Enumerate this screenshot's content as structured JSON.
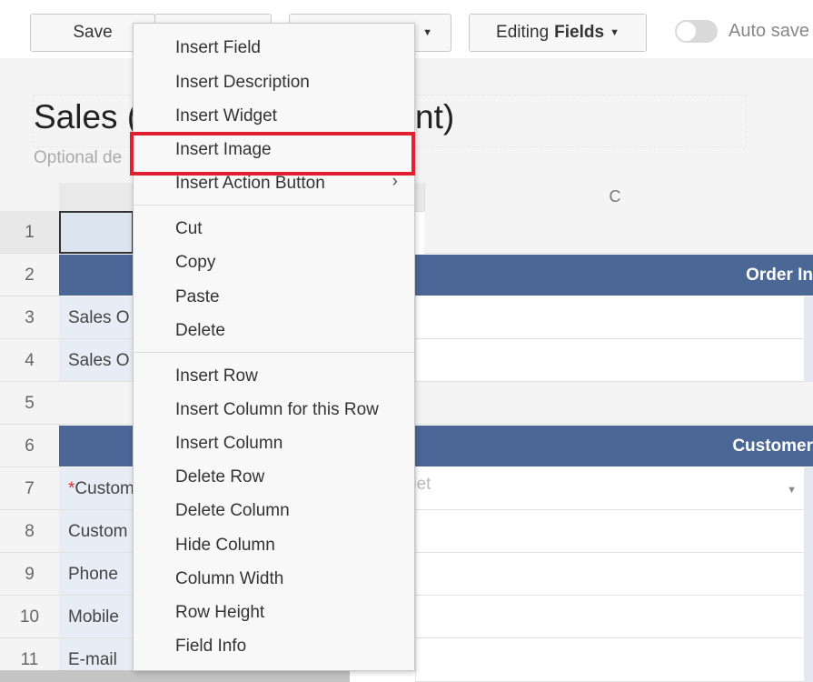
{
  "toolbar": {
    "save_label": "Save",
    "editing_prefix": "Editing",
    "editing_value": "Fields",
    "autosave_label": "Auto save"
  },
  "form": {
    "title_start": "Sales (",
    "title_end": "nt)",
    "description_placeholder": "Optional de"
  },
  "grid": {
    "column_c": "C",
    "rows": [
      "1",
      "2",
      "3",
      "4",
      "5",
      "6",
      "7",
      "8",
      "9",
      "10",
      "11"
    ],
    "labels": {
      "r3": "Sales O",
      "r4": "Sales O",
      "r7_req": "*",
      "r7": "Custom",
      "r8": "Custom",
      "r9": "Phone",
      "r10": "Mobile",
      "r11": "E-mail"
    },
    "banner_r2": "Order In",
    "banner_r6": "Customer",
    "r7_placeholder": "eet"
  },
  "menu": {
    "items": [
      "Insert Field",
      "Insert Description",
      "Insert Widget",
      "Insert Image",
      "Insert Action Button",
      "Cut",
      "Copy",
      "Paste",
      "Delete",
      "Insert Row",
      "Insert Column for this Row",
      "Insert Column",
      "Delete Row",
      "Delete Column",
      "Hide Column",
      "Column Width",
      "Row Height",
      "Field Info"
    ],
    "highlighted_item": "Insert Image"
  },
  "colors": {
    "banner": "#4a6796",
    "highlight_border": "#e02030",
    "label_bg": "#e8edf5"
  }
}
